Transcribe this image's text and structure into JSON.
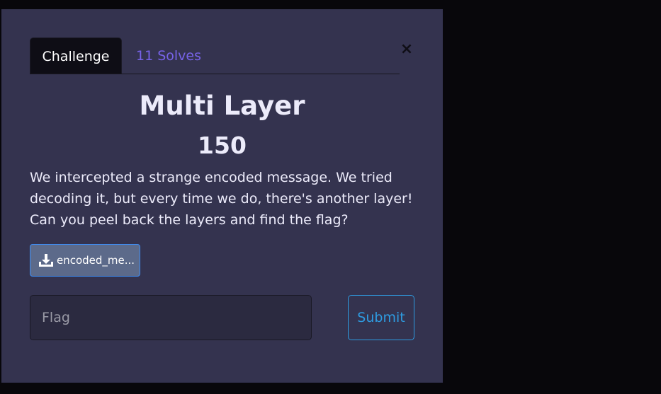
{
  "tabs": {
    "challenge_label": "Challenge",
    "solves_label": "11 Solves"
  },
  "close": {
    "label": "×"
  },
  "challenge": {
    "name": "Multi Layer",
    "points": "150",
    "description": "We intercepted a strange encoded message. We tried decoding it, but every time we do, there's another layer! Can you peel back the layers and find the flag?",
    "file_label": "encoded_me..."
  },
  "form": {
    "flag_placeholder": "Flag",
    "submit_label": "Submit"
  },
  "colors": {
    "page_bg": "#08070b",
    "modal_bg": "#34334f",
    "solves_link": "#7763e8",
    "submit_accent": "#2e9be0",
    "file_button_bg": "#5c6a8a"
  },
  "icons": {
    "file": "download-icon"
  }
}
